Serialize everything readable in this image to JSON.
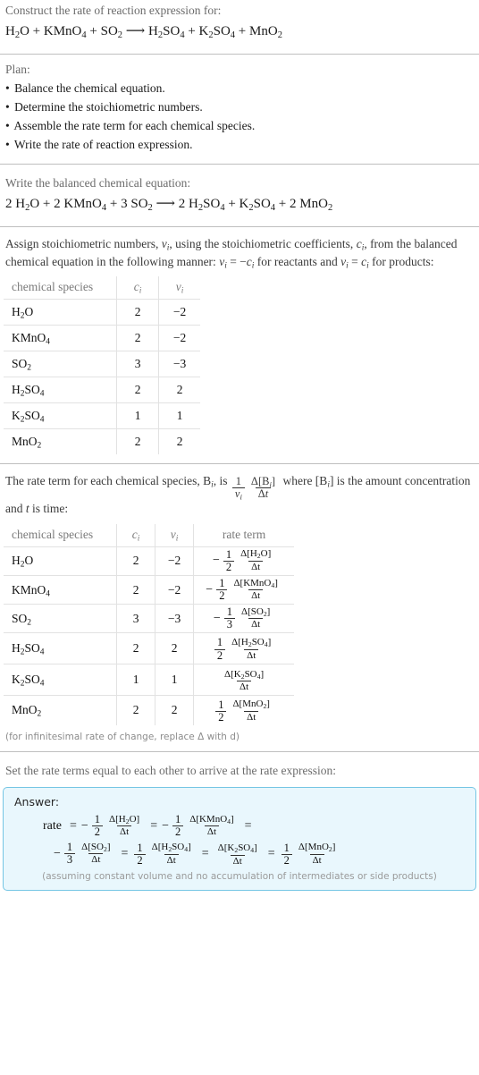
{
  "problem": {
    "prompt": "Construct the rate of reaction expression for:",
    "equation": {
      "reactants": [
        {
          "formula": "H2O",
          "html": "H<sub>2</sub>O"
        },
        {
          "formula": "KMnO4",
          "html": "KMnO<sub>4</sub>"
        },
        {
          "formula": "SO2",
          "html": "SO<sub>2</sub>"
        }
      ],
      "arrow": "⟶",
      "products": [
        {
          "formula": "H2SO4",
          "html": "H<sub>2</sub>SO<sub>4</sub>"
        },
        {
          "formula": "K2SO4",
          "html": "K<sub>2</sub>SO<sub>4</sub>"
        },
        {
          "formula": "MnO2",
          "html": "MnO<sub>2</sub>"
        }
      ],
      "text": "H2O + KMnO4 + SO2 ⟶ H2SO4 + K2SO4 + MnO2"
    }
  },
  "plan": {
    "heading": "Plan:",
    "steps": [
      "Balance the chemical equation.",
      "Determine the stoichiometric numbers.",
      "Assemble the rate term for each chemical species.",
      "Write the rate of reaction expression."
    ],
    "bullet": "•"
  },
  "balanced": {
    "heading": "Write the balanced chemical equation:",
    "text": "2 H2O + 2 KMnO4 + 3 SO2 ⟶ 2 H2SO4 + K2SO4 + 2 MnO2",
    "coefficients": {
      "H2O": 2,
      "KMnO4": 2,
      "SO2": 3,
      "H2SO4": 2,
      "K2SO4": 1,
      "MnO2": 2
    }
  },
  "stoich": {
    "paragraph_1": "Assign stoichiometric numbers, ",
    "paragraph_2": ", using the stoichiometric coefficients, ",
    "paragraph_3": ", from the balanced chemical equation in the following manner: ",
    "paragraph_4": " for reactants and ",
    "paragraph_5": " for products:",
    "nu_symbol": "ν",
    "c_symbol": "c",
    "rule_reactants": "ν = −c",
    "rule_products": "ν = c"
  },
  "table1": {
    "headers": [
      "chemical species",
      "c",
      "ν"
    ],
    "rows": [
      {
        "species_html": "H<sub>2</sub>O",
        "species": "H2O",
        "c": "2",
        "nu": "-2"
      },
      {
        "species_html": "KMnO<sub>4</sub>",
        "species": "KMnO4",
        "c": "2",
        "nu": "-2"
      },
      {
        "species_html": "SO<sub>2</sub>",
        "species": "SO2",
        "c": "3",
        "nu": "-3"
      },
      {
        "species_html": "H<sub>2</sub>SO<sub>4</sub>",
        "species": "H2SO4",
        "c": "2",
        "nu": "2"
      },
      {
        "species_html": "K<sub>2</sub>SO<sub>4</sub>",
        "species": "K2SO4",
        "c": "1",
        "nu": "1"
      },
      {
        "species_html": "MnO<sub>2</sub>",
        "species": "MnO2",
        "c": "2",
        "nu": "2"
      }
    ]
  },
  "rateterm_intro": {
    "part_1": "The rate term for each chemical species, ",
    "b_symbol": "B",
    "part_2": ", is ",
    "formula_num": "1",
    "formula_den": "ν",
    "delta_num": "Δ[B]",
    "delta_den": "Δt",
    "part_3": " where [B] is the amount concentration and ",
    "t_symbol": "t",
    "part_4": " is time:"
  },
  "table2": {
    "headers": [
      "chemical species",
      "c",
      "ν",
      "rate term"
    ],
    "rows": [
      {
        "species_html": "H<sub>2</sub>O",
        "species": "H2O",
        "c": "2",
        "nu": "-2",
        "sign": "−",
        "coef_num": "1",
        "coef_den": "2",
        "delta_num_html": "Δ[H<sub>2</sub>O]",
        "delta_den": "Δt"
      },
      {
        "species_html": "KMnO<sub>4</sub>",
        "species": "KMnO4",
        "c": "2",
        "nu": "-2",
        "sign": "−",
        "coef_num": "1",
        "coef_den": "2",
        "delta_num_html": "Δ[KMnO<sub>4</sub>]",
        "delta_den": "Δt"
      },
      {
        "species_html": "SO<sub>2</sub>",
        "species": "SO2",
        "c": "3",
        "nu": "-3",
        "sign": "−",
        "coef_num": "1",
        "coef_den": "3",
        "delta_num_html": "Δ[SO<sub>2</sub>]",
        "delta_den": "Δt"
      },
      {
        "species_html": "H<sub>2</sub>SO<sub>4</sub>",
        "species": "H2SO4",
        "c": "2",
        "nu": "2",
        "sign": "",
        "coef_num": "1",
        "coef_den": "2",
        "delta_num_html": "Δ[H<sub>2</sub>SO<sub>4</sub>]",
        "delta_den": "Δt"
      },
      {
        "species_html": "K<sub>2</sub>SO<sub>4</sub>",
        "species": "K2SO4",
        "c": "1",
        "nu": "1",
        "sign": "",
        "coef_num": "",
        "coef_den": "",
        "delta_num_html": "Δ[K<sub>2</sub>SO<sub>4</sub>]",
        "delta_den": "Δt"
      },
      {
        "species_html": "MnO<sub>2</sub>",
        "species": "MnO2",
        "c": "2",
        "nu": "2",
        "sign": "",
        "coef_num": "1",
        "coef_den": "2",
        "delta_num_html": "Δ[MnO<sub>2</sub>]",
        "delta_den": "Δt"
      }
    ],
    "footnote": "(for infinitesimal rate of change, replace Δ with d)"
  },
  "final": {
    "heading": "Set the rate terms equal to each other to arrive at the rate expression:",
    "answer_label": "Answer:",
    "rate_label": "rate",
    "equals": "=",
    "terms": [
      {
        "sign": "−",
        "coef_num": "1",
        "coef_den": "2",
        "delta_num_html": "Δ[H<sub>2</sub>O]",
        "delta_den": "Δt"
      },
      {
        "sign": "−",
        "coef_num": "1",
        "coef_den": "2",
        "delta_num_html": "Δ[KMnO<sub>4</sub>]",
        "delta_den": "Δt"
      },
      {
        "sign": "−",
        "coef_num": "1",
        "coef_den": "3",
        "delta_num_html": "Δ[SO<sub>2</sub>]",
        "delta_den": "Δt"
      },
      {
        "sign": "",
        "coef_num": "1",
        "coef_den": "2",
        "delta_num_html": "Δ[H<sub>2</sub>SO<sub>4</sub>]",
        "delta_den": "Δt"
      },
      {
        "sign": "",
        "coef_num": "",
        "coef_den": "",
        "delta_num_html": "Δ[K<sub>2</sub>SO<sub>4</sub>]",
        "delta_den": "Δt"
      },
      {
        "sign": "",
        "coef_num": "1",
        "coef_den": "2",
        "delta_num_html": "Δ[MnO<sub>2</sub>]",
        "delta_den": "Δt"
      }
    ],
    "note": "(assuming constant volume and no accumulation of intermediates or side products)"
  },
  "colors": {
    "answer_bg": "#e9f7fd",
    "answer_border": "#76c6e4",
    "rule": "#bfbfbf",
    "muted_text": "#6b6b6b",
    "table_border": "#e2e2e2"
  }
}
